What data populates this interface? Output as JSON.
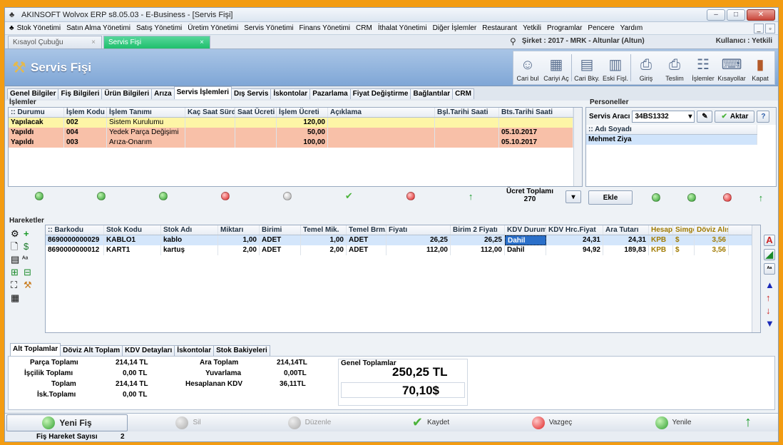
{
  "window": {
    "title": "AKINSOFT Wolvox ERP s8.05.03 - E-Business - [Servis Fişi]"
  },
  "menu": [
    "Stok Yönetimi",
    "Satın Alma Yönetimi",
    "Satış Yönetimi",
    "Üretim Yönetimi",
    "Servis Yönetimi",
    "Finans Yönetimi",
    "CRM",
    "İthalat Yönetimi",
    "Diğer İşlemler",
    "Restaurant",
    "Yetkili",
    "Programlar",
    "Pencere",
    "Yardım"
  ],
  "doc_tabs": {
    "shortcut": "Kısayol Çubuğu",
    "active": "Servis Fişi"
  },
  "company": "Şirket : 2017 - MRK - Altunlar (Altun)",
  "user": "Kullanıcı : Yetkili",
  "page_title": "Servis Fişi",
  "toolbar": [
    {
      "label": "Cari bul",
      "icon": "user-search-icon"
    },
    {
      "label": "Cariyi Aç",
      "icon": "calendar-icon"
    },
    {
      "label": "Cari Bky.",
      "icon": "document-icon"
    },
    {
      "label": "Eski Fişl.",
      "icon": "building-icon"
    },
    {
      "label": "Giriş",
      "icon": "printer-in-icon"
    },
    {
      "label": "Teslim",
      "icon": "printer-out-icon"
    },
    {
      "label": "İşlemler",
      "icon": "gear-list-icon"
    },
    {
      "label": "Kısayollar",
      "icon": "keyboard-icon"
    },
    {
      "label": "Kapat",
      "icon": "exit-door-icon"
    }
  ],
  "page_tabs": [
    "Genel Bilgiler",
    "Fiş Bilgileri",
    "Ürün Bilgileri",
    "Arıza",
    "Servis İşlemleri",
    "Dış Servis",
    "İskontolar",
    "Pazarlama",
    "Fiyat Değiştirme",
    "Bağlantılar",
    "CRM"
  ],
  "islemler": {
    "title": "İşlemler",
    "columns": [
      ":: Durumu",
      "İşlem Kodu",
      "İşlem Tanımı",
      "Kaç Saat Sürdü",
      "Saat Ücreti",
      "İşlem Ücreti",
      "Açıklama",
      "Bşl.Tarihi Saati",
      "Bts.Tarihi Saati"
    ],
    "rows": [
      {
        "durum": "Yapılacak",
        "kod": "002",
        "tanim": "Sistem Kurulumu",
        "ucret": "120,00",
        "bts": ""
      },
      {
        "durum": "Yapıldı",
        "kod": "004",
        "tanim": "Yedek Parça Değişimi",
        "ucret": "50,00",
        "bts": "05.10.2017"
      },
      {
        "durum": "Yapıldı",
        "kod": "003",
        "tanim": "Arıza-Onarım",
        "ucret": "100,00",
        "bts": "05.10.2017"
      }
    ],
    "ucret_toplami_label": "Ücret Toplamı",
    "ucret_toplami": "270"
  },
  "personeller": {
    "title": "Personeller",
    "arac_label": "Servis Aracı",
    "arac_value": "34BS1332",
    "aktar": "Aktar",
    "col": ":: Adı Soyadı",
    "rows": [
      "Mehmet Ziya"
    ],
    "ekle": "Ekle"
  },
  "hareketler": {
    "title": "Hareketler",
    "columns": [
      ":: Barkodu",
      "Stok Kodu",
      "Stok Adı",
      "Miktarı",
      "Birimi",
      "Temel Mik.",
      "Temel Brm.",
      "Fiyatı",
      "Birim 2 Fiyatı",
      "KDV Durumu",
      "KDV Hrc.Fiyat",
      "Ara Tutarı",
      "Hesap",
      "Simge",
      "Döviz Alış"
    ],
    "rows": [
      {
        "barkod": "8690000000029",
        "kod": "KABLO1",
        "ad": "kablo",
        "miktar": "1,00",
        "birim": "ADET",
        "tmik": "1,00",
        "tbrm": "ADET",
        "fiyat": "26,25",
        "b2": "26,25",
        "kdv": "Dahil",
        "kdvh": "24,31",
        "ara": "24,31",
        "hesap": "KPB",
        "simge": "$",
        "doviz": "3,56"
      },
      {
        "barkod": "8690000000012",
        "kod": "KART1",
        "ad": "kartuş",
        "miktar": "2,00",
        "birim": "ADET",
        "tmik": "2,00",
        "tbrm": "ADET",
        "fiyat": "112,00",
        "b2": "112,00",
        "kdv": "Dahil",
        "kdvh": "94,92",
        "ara": "189,83",
        "hesap": "KPB",
        "simge": "$",
        "doviz": "3,56"
      }
    ]
  },
  "bottom_tabs": [
    "Alt Toplamlar",
    "Döviz Alt Toplam",
    "KDV Detayları",
    "İskontolar",
    "Stok Bakiyeleri"
  ],
  "totals": {
    "parca_label": "Parça Toplamı",
    "parca": "214,14 TL",
    "iscilik_label": "İşçilik Toplamı",
    "iscilik": "0,00 TL",
    "toplam_label": "Toplam",
    "toplam": "214,14 TL",
    "isk_label": "İsk.Toplamı",
    "isk": "0,00 TL",
    "ara_label": "Ara Toplam",
    "ara": "214,14TL",
    "yuv_label": "Yuvarlama",
    "yuv": "0,00TL",
    "kdv_label": "Hesaplanan KDV",
    "kdv": "36,11TL",
    "genel_label": "Genel Toplamlar",
    "genel_tl": "250,25 TL",
    "genel_usd": "70,10$"
  },
  "actions": {
    "yeni": "Yeni Fiş",
    "sil": "Sil",
    "duzenle": "Düzenle",
    "kaydet": "Kaydet",
    "vazgec": "Vazgeç",
    "yenile": "Yenile"
  },
  "status": {
    "label": "Fiş Hareket Sayısı",
    "value": "2"
  },
  "colors": {
    "yellow_row": "#fdf5a6",
    "pink_row": "#f8c0a8",
    "header_blue": "#7fa6d6",
    "active_tab": "#1fbf6c",
    "frame": "#f39c12"
  }
}
